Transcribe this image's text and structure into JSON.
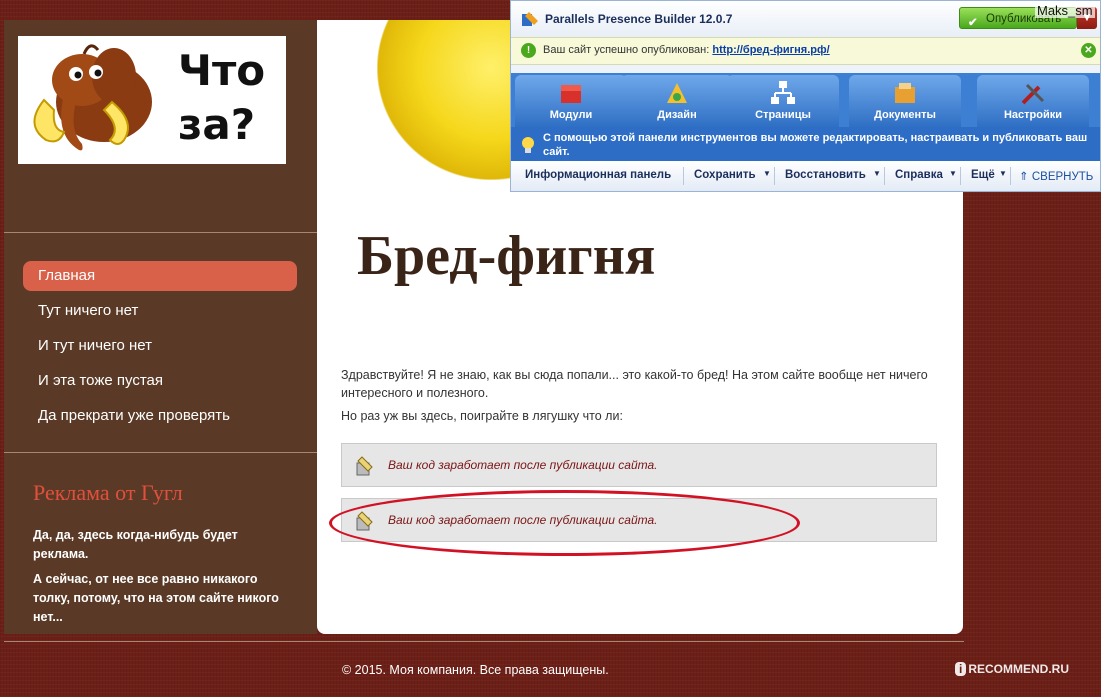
{
  "logo": {
    "text_line1": "Что",
    "text_line2": "за?"
  },
  "nav": {
    "items": [
      {
        "label": "Главная",
        "active": true
      },
      {
        "label": "Тут ничего нет",
        "active": false
      },
      {
        "label": "И тут ничего нет",
        "active": false
      },
      {
        "label": "И эта тоже пустая",
        "active": false
      },
      {
        "label": "Да прекрати уже проверять",
        "active": false
      }
    ]
  },
  "ad": {
    "title": "Реклама от Гугл",
    "text1": "Да, да, здесь когда-нибудь будет реклама.",
    "text2": "А сейчас, от нее все равно никакого толку, потому, что на этом сайте никого нет..."
  },
  "main": {
    "title": "Бред-фигня",
    "para1": "Здравствуйте! Я не знаю, как вы сюда попали... это какой-то бред! На этом сайте вообще нет ничего интересного и полезного.",
    "para2": "Но раз уж вы здесь, поиграйте в лягушку что ли:",
    "code_placeholder_1": "Ваш код заработает после публикации сайта.",
    "code_placeholder_2": "Ваш код заработает после публикации сайта."
  },
  "footer": {
    "copyright": "© 2015. Моя компания. Все права защищены."
  },
  "watermark": {
    "badge": "i",
    "text": "RECOMMEND.RU"
  },
  "panel": {
    "title": "Parallels Presence Builder 12.0.7",
    "publish_label": "Опубликовать",
    "user": "Maks_sm",
    "status_text": "Ваш сайт успешно опубликован:",
    "status_link": "http://бред-фигня.рф/",
    "tabs": [
      {
        "label": "Модули",
        "icon": "modules-icon"
      },
      {
        "label": "Дизайн",
        "icon": "design-icon"
      },
      {
        "label": "Страницы",
        "icon": "pages-icon"
      },
      {
        "label": "Документы",
        "icon": "documents-icon"
      },
      {
        "label": "Настройки",
        "icon": "settings-icon"
      }
    ],
    "info_text": "С помощью этой панели инструментов вы можете редактировать, настраивать и публиковать ваш сайт.",
    "toolbar": {
      "info_panel": "Информационная панель",
      "save": "Сохранить",
      "restore": "Восстановить",
      "help": "Справка",
      "more": "Ещё",
      "collapse": "СВЕРНУТЬ"
    }
  },
  "colors": {
    "brand_brown": "#5a3a26",
    "accent_red": "#d9614a",
    "panel_blue": "#3d7fd2",
    "ellipse_red": "#d21224"
  }
}
